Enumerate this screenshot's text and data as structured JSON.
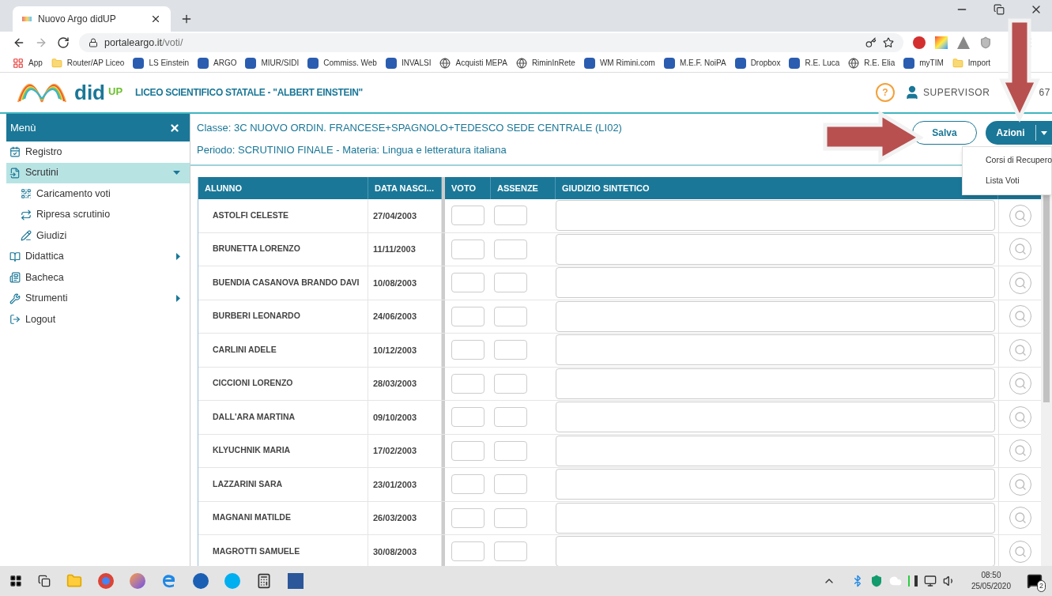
{
  "browser": {
    "tab_title": "Nuovo Argo didUP",
    "url_host": "portaleargo.it",
    "url_path": "/voti/",
    "bookmarks": [
      {
        "label": "App",
        "kind": "apps"
      },
      {
        "label": "Router/AP Liceo",
        "kind": "folder"
      },
      {
        "label": "LS Einstein",
        "kind": "site"
      },
      {
        "label": "ARGO",
        "kind": "site"
      },
      {
        "label": "MIUR/SIDI",
        "kind": "site"
      },
      {
        "label": "Commiss. Web",
        "kind": "site"
      },
      {
        "label": "INVALSI",
        "kind": "site"
      },
      {
        "label": "Acquisti MEPA",
        "kind": "globe"
      },
      {
        "label": "RiminInRete",
        "kind": "globe"
      },
      {
        "label": "WM Rimini.com",
        "kind": "site"
      },
      {
        "label": "M.E.F. NoiPA",
        "kind": "site"
      },
      {
        "label": "Dropbox",
        "kind": "site"
      },
      {
        "label": "R.E. Luca",
        "kind": "site"
      },
      {
        "label": "R.E. Elia",
        "kind": "globe"
      },
      {
        "label": "myTIM",
        "kind": "site"
      },
      {
        "label": "Import",
        "kind": "folder"
      }
    ]
  },
  "header": {
    "logo": "did",
    "logo_sup": "UP",
    "school": "LICEO SCIENTIFICO STATALE - \"ALBERT EINSTEIN\"",
    "help": "?",
    "user": "SUPERVISOR",
    "user_tail": "67"
  },
  "sidebar": {
    "title": "Menù",
    "items": [
      {
        "label": "Registro",
        "selected": false
      },
      {
        "label": "Scrutini",
        "selected": true,
        "expanded": true,
        "children": [
          {
            "label": "Caricamento voti"
          },
          {
            "label": "Ripresa scrutinio"
          },
          {
            "label": "Giudizi"
          }
        ]
      },
      {
        "label": "Didattica",
        "selected": false,
        "expanded": false
      },
      {
        "label": "Bacheca",
        "selected": false
      },
      {
        "label": "Strumenti",
        "selected": false,
        "expanded": false
      },
      {
        "label": "Logout",
        "selected": false
      }
    ]
  },
  "content": {
    "classe": "Classe: 3C NUOVO ORDIN. FRANCESE+SPAGNOLO+TEDESCO SEDE CENTRALE (LI02)",
    "periodo": "Periodo: SCRUTINIO FINALE - Materia: Lingua e letteratura italiana",
    "save_button": "Salva",
    "actions_button": "Azioni",
    "actions_menu": [
      "Corsi di Recupero",
      "Lista Voti"
    ]
  },
  "table": {
    "columns": [
      "ALUNNO",
      "DATA NASCI...",
      "VOTO",
      "ASSENZE",
      "GIUDIZIO SINTETICO"
    ],
    "rows": [
      {
        "name": "ASTOLFI CELESTE",
        "birth": "27/04/2003"
      },
      {
        "name": "BRUNETTA LORENZO",
        "birth": "11/11/2003"
      },
      {
        "name": "BUENDIA CASANOVA BRANDO DAVI",
        "birth": "10/08/2003"
      },
      {
        "name": "BURBERI LEONARDO",
        "birth": "24/06/2003"
      },
      {
        "name": "CARLINI ADELE",
        "birth": "10/12/2003"
      },
      {
        "name": "CICCIONI LORENZO",
        "birth": "28/03/2003"
      },
      {
        "name": "DALL'ARA MARTINA",
        "birth": "09/10/2003"
      },
      {
        "name": "KLYUCHNIK MARIA",
        "birth": "17/02/2003"
      },
      {
        "name": "LAZZARINI SARA",
        "birth": "23/01/2003"
      },
      {
        "name": "MAGNANI MATILDE",
        "birth": "26/03/2003"
      },
      {
        "name": "MAGROTTI SAMUELE",
        "birth": "30/08/2003"
      }
    ]
  },
  "taskbar": {
    "time": "08:50",
    "date": "25/05/2020",
    "notifications": "2"
  }
}
